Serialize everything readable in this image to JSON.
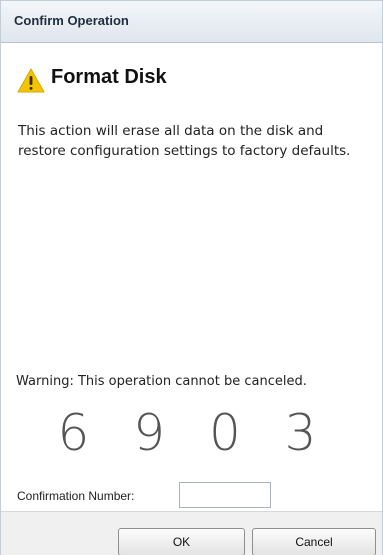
{
  "dialog": {
    "title": "Confirm Operation",
    "heading": "Format Disk",
    "heading_icon": "warning-triangle-icon",
    "description": "This action will erase all data on the disk and restore configuration settings to factory defaults.",
    "warning": "Warning: This operation cannot be canceled.",
    "confirmation_digits": [
      "6",
      "9",
      "0",
      "3"
    ],
    "confirmation_label": "Confirmation Number:",
    "confirmation_value": "",
    "ok_label": "OK",
    "cancel_label": "Cancel"
  },
  "colors": {
    "warning_yellow": "#f5c400",
    "titlebar_top": "#f3f6f9",
    "titlebar_bottom": "#dfe6ee"
  }
}
